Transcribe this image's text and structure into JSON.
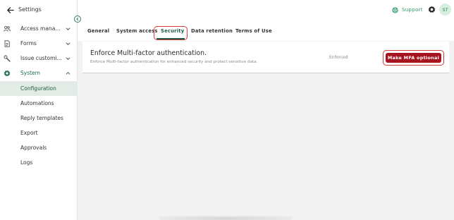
{
  "sidebar": {
    "title": "Settings",
    "items": [
      {
        "label": "Access mana...",
        "icon": "people-icon"
      },
      {
        "label": "Forms",
        "icon": "document-icon"
      },
      {
        "label": "Issue customi...",
        "icon": "wrench-icon"
      },
      {
        "label": "System",
        "icon": "gear-icon"
      }
    ],
    "sub_items": [
      {
        "label": "Configuration",
        "selected": true
      },
      {
        "label": "Automations"
      },
      {
        "label": "Reply templates"
      },
      {
        "label": "Export"
      },
      {
        "label": "Approvals"
      },
      {
        "label": "Logs"
      }
    ]
  },
  "topbar": {
    "support_label": "Support",
    "avatar_initials": "ST"
  },
  "tabs": [
    {
      "label": "General"
    },
    {
      "label": "System access"
    },
    {
      "label": "Security",
      "active": true
    },
    {
      "label": "Data retention"
    },
    {
      "label": "Terms of Use"
    }
  ],
  "mfa_card": {
    "title": "Enforce Multi-factor authentication.",
    "description": "Enforce Multi-factor authentication for enhanced security and protect sensitive data.",
    "status": "Enforced",
    "button_label": "Make MFA optional"
  },
  "colors": {
    "accent": "#1f5c42",
    "support": "#2f9a6a",
    "danger_button": "#a5141e",
    "highlight": "#d33b3b"
  }
}
